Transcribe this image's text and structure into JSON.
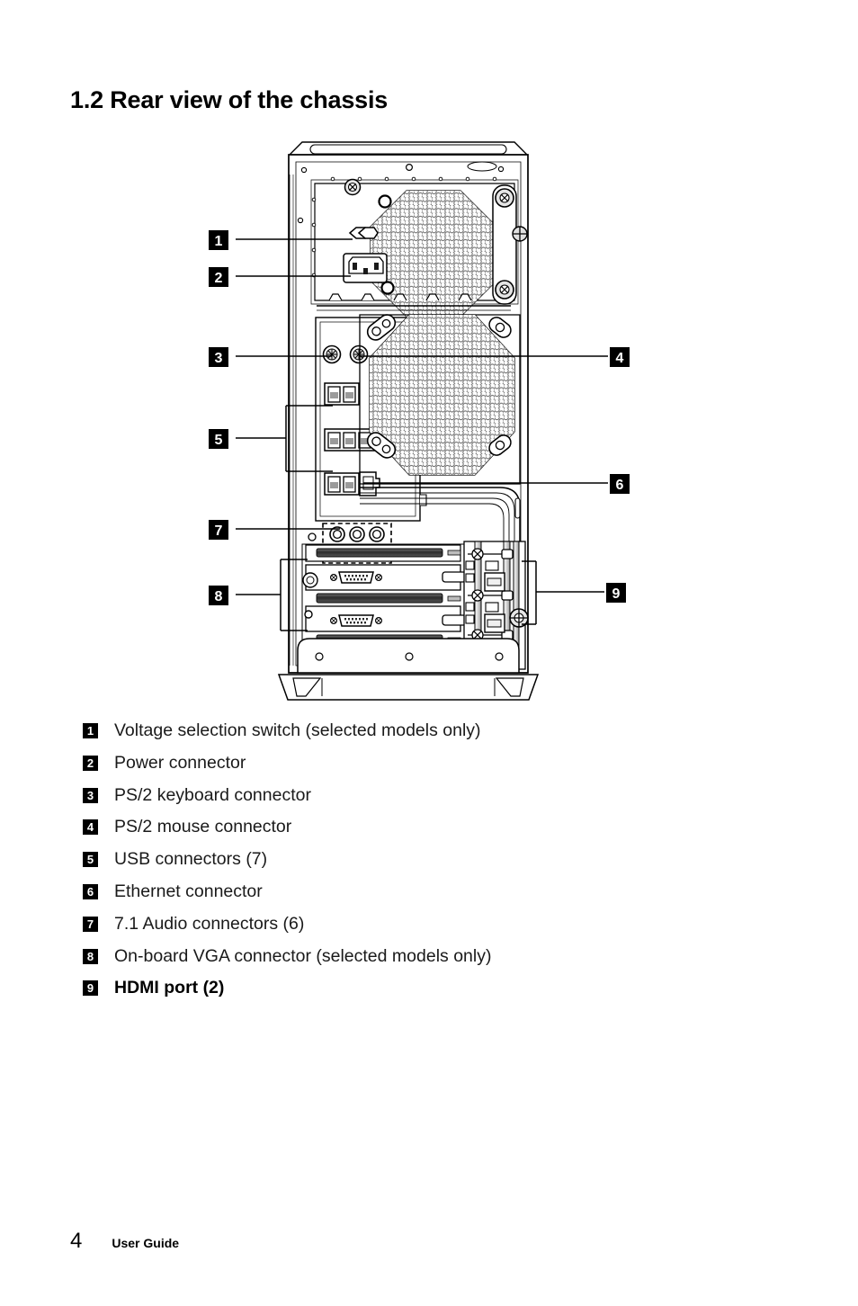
{
  "document": {
    "title": "1.2 Rear view of the chassis"
  },
  "legend": {
    "items": [
      {
        "number": "1",
        "label": "Voltage selection switch (selected models only)",
        "emphasis": false
      },
      {
        "number": "2",
        "label": "Power connector",
        "emphasis": false
      },
      {
        "number": "3",
        "label": "PS/2 keyboard connector",
        "emphasis": false
      },
      {
        "number": "4",
        "label": "PS/2 mouse connector",
        "emphasis": false
      },
      {
        "number": "5",
        "label": "USB connectors (7)",
        "emphasis": false
      },
      {
        "number": "6",
        "label": "Ethernet connector",
        "emphasis": false
      },
      {
        "number": "7",
        "label": "7.1 Audio connectors (6)",
        "emphasis": false
      },
      {
        "number": "8",
        "label": "On-board VGA connector (selected models only)",
        "emphasis": false
      },
      {
        "number": "9",
        "label": "HDMI port (2)",
        "emphasis": true
      }
    ]
  },
  "diagram": {
    "description": "Line drawing of the rear panel of a desktop tower chassis",
    "callouts": [
      {
        "number": "1",
        "target": "voltage-selection-switch",
        "side": "left",
        "style": "line"
      },
      {
        "number": "2",
        "target": "power-connector",
        "side": "left",
        "style": "line"
      },
      {
        "number": "3",
        "target": "ps2-keyboard-connector",
        "side": "left",
        "style": "line"
      },
      {
        "number": "4",
        "target": "ps2-mouse-connector",
        "side": "right",
        "style": "line"
      },
      {
        "number": "5",
        "target": "usb-connectors",
        "side": "left",
        "style": "bracket"
      },
      {
        "number": "6",
        "target": "ethernet-connector",
        "side": "right",
        "style": "line"
      },
      {
        "number": "7",
        "target": "audio-connectors",
        "side": "left",
        "style": "line"
      },
      {
        "number": "8",
        "target": "onboard-vga-connector",
        "side": "left",
        "style": "bracket"
      },
      {
        "number": "9",
        "target": "hdmi-ports",
        "side": "right",
        "style": "bracket"
      }
    ],
    "components": {
      "psu_fan_grille": "honeycomb perforated vent",
      "case_fan_grille": "honeycomb perforated vent",
      "expansion_slots": 4,
      "ps2_ports": 2,
      "usb_groups": [
        2,
        3,
        2
      ],
      "audio_jacks": 6,
      "vga_ports": 2,
      "hdmi_ports": 2
    }
  },
  "footer": {
    "page_number": "4",
    "guide_label": "User Guide"
  },
  "colors": {
    "ink": "#000000",
    "badge_bg": "#000000",
    "badge_fg": "#ffffff",
    "paper": "#ffffff",
    "metal_light": "#f2f2f2",
    "metal_mid": "#d8d8d8",
    "metal_dark": "#8c8c8c"
  }
}
